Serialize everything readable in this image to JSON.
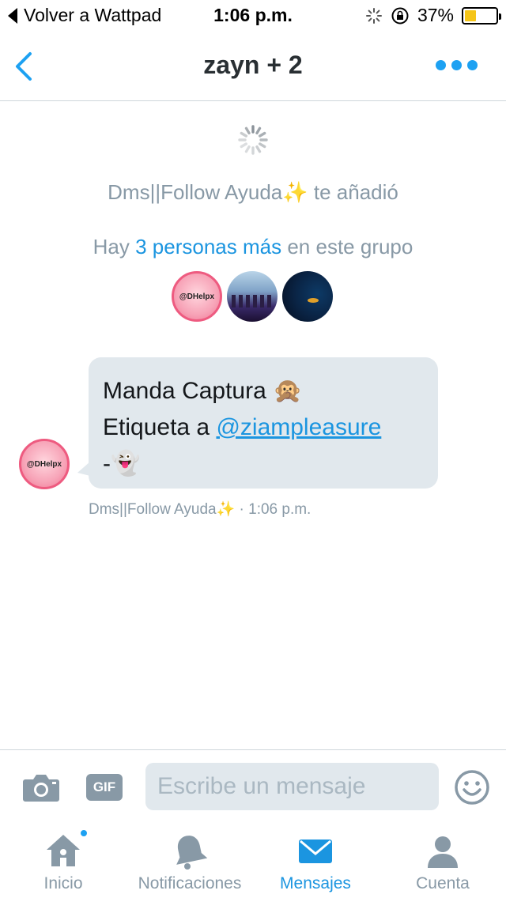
{
  "status_bar": {
    "back_label": "Volver a Wattpad",
    "time": "1:06 p.m.",
    "battery_text": "37%",
    "battery_level": 0.37
  },
  "header": {
    "title": "zayn + 2",
    "accent": "#1da1f2"
  },
  "conversation": {
    "added_by_name": "Dms||Follow Ayuda✨",
    "added_text": "te añadió",
    "group_prefix": "Hay",
    "group_link": "3 personas más",
    "group_suffix": "en este grupo",
    "avatar_label": "@DHelpx",
    "message": {
      "line1": "Manda Captura 🙊",
      "line2_prefix": "Etiqueta a",
      "mention": "@ziampleasure",
      "line3": "-👻",
      "meta": "Dms||Follow Ayuda✨ · 1:06 p.m."
    }
  },
  "composer": {
    "gif_label": "GIF",
    "placeholder": "Escribe un mensaje"
  },
  "tabs": [
    {
      "label": "Inicio",
      "icon": "home-icon"
    },
    {
      "label": "Notificaciones",
      "icon": "bell-icon"
    },
    {
      "label": "Mensajes",
      "icon": "envelope-icon"
    },
    {
      "label": "Cuenta",
      "icon": "person-icon"
    }
  ],
  "colors": {
    "accent": "#1b95e0",
    "muted": "#8899a6",
    "bubble": "#e1e8ed"
  }
}
